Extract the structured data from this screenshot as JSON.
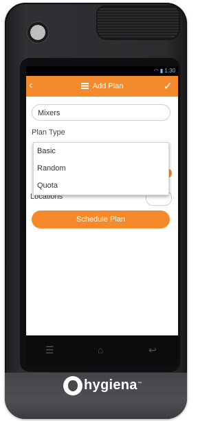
{
  "status_bar": {
    "time": "1:30",
    "wifi_icon": "wifi-icon",
    "battery_icon": "battery-icon"
  },
  "app_bar": {
    "title": "Add Plan",
    "back_icon": "back-icon",
    "menu_icon": "menu-icon",
    "confirm_icon": "check-icon"
  },
  "form": {
    "name_value": "Mixers",
    "plan_type_label": "Plan Type",
    "plan_type_options": [
      "Basic",
      "Random",
      "Quota"
    ],
    "locations_label": "Locations",
    "schedule_button": "Schedule Plan"
  },
  "nav": {
    "menu": "☰",
    "home": "⌂",
    "back": "↩"
  },
  "brand": {
    "name": "hygiena",
    "tm": "™"
  },
  "colors": {
    "accent": "#f58a2d",
    "device": "#2b2d30"
  }
}
